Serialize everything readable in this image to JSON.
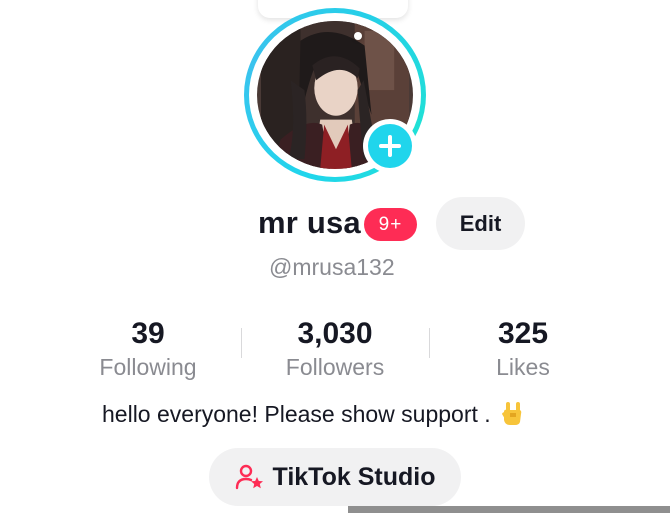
{
  "profile": {
    "display_name": "mr usa",
    "notification_badge": "9+",
    "handle": "@mrusa132",
    "edit_label": "Edit",
    "bio": "hello everyone! Please show support .",
    "bio_emoji": "rock-hand-emoji-icon"
  },
  "stats": {
    "following": {
      "value": "39",
      "label": "Following"
    },
    "followers": {
      "value": "3,030",
      "label": "Followers"
    },
    "likes": {
      "value": "325",
      "label": "Likes"
    }
  },
  "studio": {
    "label": "TikTok Studio",
    "icon": "creator-star-icon"
  },
  "icons": {
    "add": "plus-icon"
  },
  "colors": {
    "ring": "#20d5ec",
    "badge": "#fe2c55",
    "button_bg": "#f1f1f2",
    "secondary_text": "#8a8b91",
    "studio_icon": "#fe2c55"
  }
}
